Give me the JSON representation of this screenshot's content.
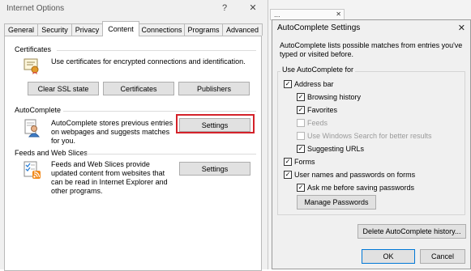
{
  "internet_options": {
    "title": "Internet Options",
    "help_glyph": "?",
    "close_glyph": "✕",
    "tabs": [
      "General",
      "Security",
      "Privacy",
      "Content",
      "Connections",
      "Programs",
      "Advanced"
    ],
    "active_tab": "Content",
    "certificates": {
      "title": "Certificates",
      "description": "Use certificates for encrypted connections and identification.",
      "buttons": [
        "Clear SSL state",
        "Certificates",
        "Publishers"
      ],
      "icon": "certificate-icon"
    },
    "autocomplete": {
      "title": "AutoComplete",
      "description": "AutoComplete stores previous entries on webpages and suggests matches for you.",
      "settings_label": "Settings",
      "icon": "autocomplete-user-icon",
      "highlight_color": "#d4222a"
    },
    "feeds": {
      "title": "Feeds and Web Slices",
      "description": "Feeds and Web Slices provide updated content from websites that can be read in Internet Explorer and other programs.",
      "settings_label": "Settings",
      "icon": "feeds-icon"
    }
  },
  "background_tab": {
    "text": "...",
    "close_glyph": "✕"
  },
  "autocomplete_dialog": {
    "title": "AutoComplete Settings",
    "close_glyph": "✕",
    "description": "AutoComplete lists possible matches from entries you've typed or visited before.",
    "group_title": "Use AutoComplete for",
    "items": {
      "address_bar": {
        "label": "Address bar",
        "checked": true
      },
      "browsing_history": {
        "label": "Browsing history",
        "checked": true
      },
      "favorites": {
        "label": "Favorites",
        "checked": true
      },
      "feeds": {
        "label": "Feeds",
        "checked": false,
        "disabled": true
      },
      "windows_search": {
        "label": "Use Windows Search for better results",
        "checked": false,
        "disabled": true
      },
      "suggesting_urls": {
        "label": "Suggesting URLs",
        "checked": true
      },
      "forms": {
        "label": "Forms",
        "checked": true
      },
      "usernames": {
        "label": "User names and passwords on forms",
        "checked": true
      },
      "ask_before_saving": {
        "label": "Ask me before saving passwords",
        "checked": true
      }
    },
    "manage_passwords_label": "Manage Passwords",
    "delete_history_label": "Delete AutoComplete history...",
    "ok_label": "OK",
    "cancel_label": "Cancel",
    "check_glyph": "✓"
  }
}
